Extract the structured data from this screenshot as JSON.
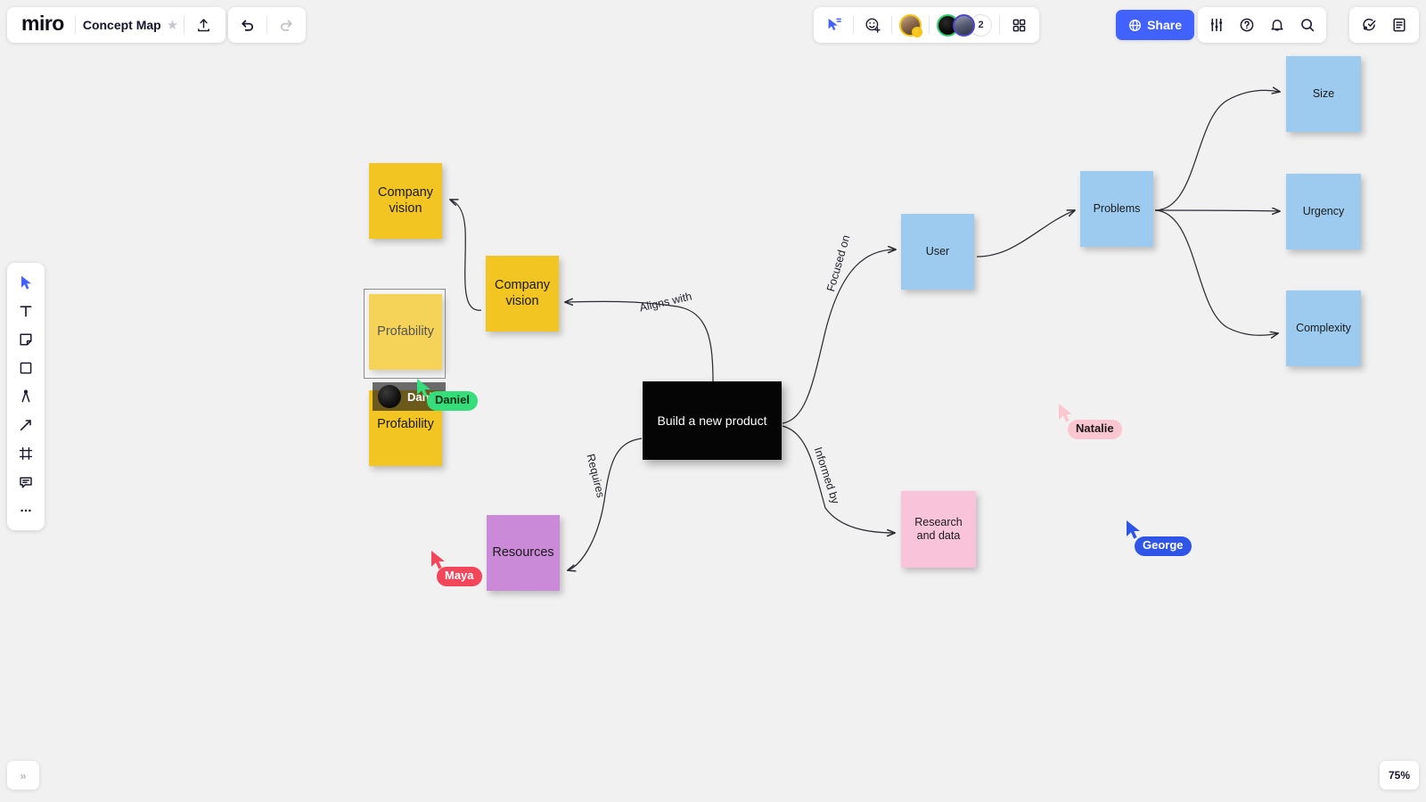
{
  "app": {
    "logo": "miro",
    "board_title": "Concept Map",
    "zoom_level": "75%",
    "expand_label": "»"
  },
  "header": {
    "star_icon": "★",
    "upload_icon": "upload-icon",
    "undo_icon": "undo-icon",
    "redo_icon": "redo-icon",
    "share_label": "Share",
    "collab_count": "2",
    "icons": [
      "cursor-share-icon",
      "emoji-reaction-icon",
      "apps-grid-icon",
      "settings-sliders-icon",
      "help-icon",
      "notifications-icon",
      "search-icon",
      "ai-sparkle-icon",
      "notes-panel-icon"
    ]
  },
  "toolbar": {
    "items": [
      {
        "name": "select",
        "icon": "cursor-icon",
        "active": true
      },
      {
        "name": "text",
        "icon": "text-icon",
        "active": false
      },
      {
        "name": "sticky-note",
        "icon": "sticky-note-icon",
        "active": false
      },
      {
        "name": "shape",
        "icon": "shape-square-icon",
        "active": false
      },
      {
        "name": "pen",
        "icon": "pen-icon",
        "active": false
      },
      {
        "name": "connector",
        "icon": "arrow-line-icon",
        "active": false
      },
      {
        "name": "frame",
        "icon": "frame-icon",
        "active": false
      },
      {
        "name": "comment",
        "icon": "comment-icon",
        "active": false
      },
      {
        "name": "more",
        "icon": "more-dots-icon",
        "active": false
      }
    ]
  },
  "colors": {
    "yellow": "#f2c522",
    "blue": "#9dcbf0",
    "pink": "#f9c3da",
    "purple": "#cb8ad8",
    "black": "#050505",
    "accent": "#4262ff"
  },
  "board": {
    "hub": {
      "label": "Build a new product"
    },
    "notes": [
      {
        "id": "company-vision-1",
        "label": "Company vision",
        "color": "yellow"
      },
      {
        "id": "company-vision-2",
        "label": "Company vision",
        "color": "yellow"
      },
      {
        "id": "profability-1",
        "label": "Profability",
        "color": "yellow"
      },
      {
        "id": "profability-2",
        "label": "Profability",
        "color": "yellow"
      },
      {
        "id": "resources",
        "label": "Resources",
        "color": "purple"
      },
      {
        "id": "user",
        "label": "User",
        "color": "blue"
      },
      {
        "id": "research-and-data",
        "label": "Research and data",
        "color": "pink"
      },
      {
        "id": "problems",
        "label": "Problems",
        "color": "blue"
      },
      {
        "id": "size",
        "label": "Size",
        "color": "blue"
      },
      {
        "id": "urgency",
        "label": "Urgency",
        "color": "blue"
      },
      {
        "id": "complexity",
        "label": "Complexity",
        "color": "blue"
      }
    ],
    "connector_labels": [
      {
        "id": "aligns-with",
        "label": "Aligns with"
      },
      {
        "id": "focused-on",
        "label": "Focused on"
      },
      {
        "id": "informed-by",
        "label": "Informed by"
      },
      {
        "id": "requires",
        "label": "Requires"
      }
    ],
    "editing_note": {
      "user": "Daniel"
    },
    "cursors": [
      {
        "name": "Daniel",
        "color": "#35de7b",
        "text": "#0b2c18"
      },
      {
        "name": "Natalie",
        "color": "#fbc6cf",
        "text": "#1a1a1a"
      },
      {
        "name": "George",
        "color": "#2f55e8",
        "text": "#ffffff"
      },
      {
        "name": "Maya",
        "color": "#f4465a",
        "text": "#ffffff"
      }
    ]
  }
}
